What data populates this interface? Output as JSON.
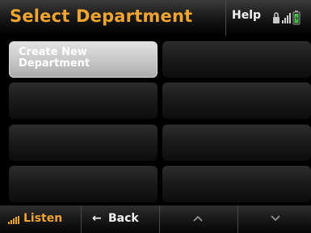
{
  "header": {
    "title": "Select Department",
    "help_label": "Help",
    "status_icons": [
      "lock-icon",
      "signal-icon",
      "battery-icon"
    ]
  },
  "tiles": [
    {
      "label": "Create New Department",
      "state": "selected"
    },
    {
      "label": "",
      "state": "empty"
    },
    {
      "label": "",
      "state": "empty"
    },
    {
      "label": "",
      "state": "empty"
    },
    {
      "label": "",
      "state": "empty"
    },
    {
      "label": "",
      "state": "empty"
    },
    {
      "label": "",
      "state": "empty"
    },
    {
      "label": "",
      "state": "empty"
    }
  ],
  "footer": {
    "listen_label": "Listen",
    "back_label": "Back",
    "back_icon": "left-arrow-icon",
    "up_icon": "chevron-up-icon",
    "down_icon": "chevron-down-icon"
  },
  "colors": {
    "accent": "#f0a432",
    "battery": "#4ec34e",
    "selected_tile": "#c9c9c9"
  }
}
